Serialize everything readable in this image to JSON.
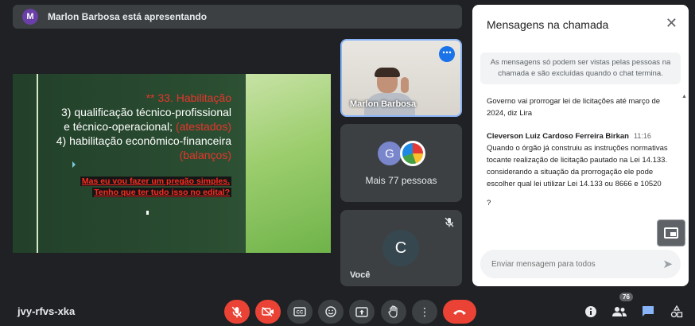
{
  "banner": {
    "avatar_letter": "M",
    "text": "Marlon Barbosa está apresentando"
  },
  "slide": {
    "heading": "** 33. Habilitação",
    "line1": "3) qualificação técnico-profissional",
    "line2a": "e técnico-operacional; ",
    "line2b": "(atestados)",
    "line3": "4) habilitação econômico-financeira",
    "line4": "(balanços)",
    "question1": "Mas eu vou fazer um pregão simples.",
    "question2": "Tenho que ter tudo isso no edital?"
  },
  "tiles": {
    "presenter": {
      "name": "Marlon Barbosa",
      "more_icon": "more-options-icon"
    },
    "others": {
      "avatar_letter": "G",
      "label": "Mais 77 pessoas"
    },
    "self": {
      "avatar_letter": "C",
      "name": "Você",
      "mic_icon": "mic-off-icon"
    }
  },
  "chat": {
    "title": "Mensagens na chamada",
    "notice": "As mensagens só podem ser vistas pelas pessoas na chamada e são excluídas quando o chat termina.",
    "messages": [
      {
        "text": "Governo vai prorrogar lei de licitações até março de 2024, diz Lira"
      },
      {
        "sender": "Cleverson Luiz Cardoso Ferreira Birkan",
        "time": "11:16",
        "text": "Quando o órgão já construiu as instruções normativas tocante realização de licitação pautado na Lei 14.133. considerando a situação da prorrogação ele pode escolher  qual lei utilizar Lei 14.133 ou 8666 e 10520"
      },
      {
        "text": "?"
      }
    ],
    "input_placeholder": "Enviar mensagem para todos"
  },
  "bottom": {
    "meeting_code": "jvy-rfvs-xka",
    "participants_count": "76"
  },
  "colors": {
    "accent": "#8ab4f8",
    "danger": "#ea4335",
    "background": "#202124",
    "slide_red": "#e8352b"
  }
}
